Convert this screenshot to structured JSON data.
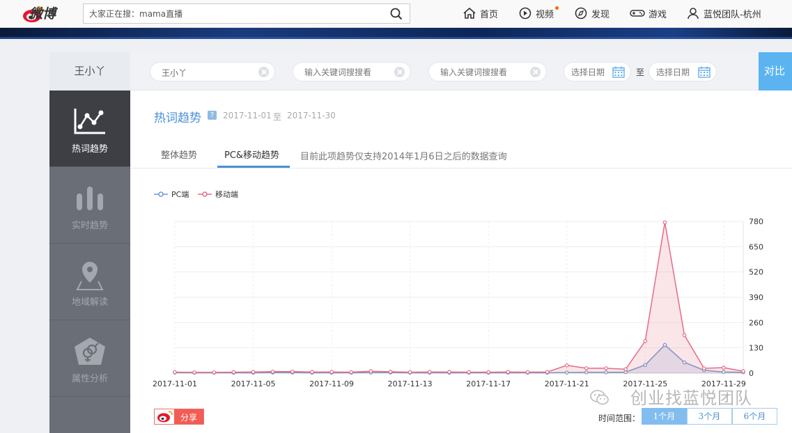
{
  "topbar": {
    "logo_text": "微博",
    "search_placeholder": "大家正在搜：mama直播",
    "nav": [
      {
        "label": "首页",
        "icon": "home-icon"
      },
      {
        "label": "视频",
        "icon": "video-icon"
      },
      {
        "label": "发现",
        "icon": "compass-icon"
      },
      {
        "label": "游戏",
        "icon": "gamepad-icon"
      },
      {
        "label": "蓝悦团队-杭州",
        "icon": "user-icon"
      }
    ]
  },
  "filters": {
    "keyword_label": "王小丫",
    "keyword1_value": "王小丫",
    "keyword2_placeholder": "输入关键词搜搜看",
    "keyword3_placeholder": "输入关键词搜搜看",
    "date_start_placeholder": "选择日期",
    "date_to": "至",
    "date_end_placeholder": "选择日期",
    "compare_label": "对比"
  },
  "sidebar": {
    "items": [
      {
        "label": "热词趋势",
        "icon": "trend-chart-icon",
        "active": true
      },
      {
        "label": "实时趋势",
        "icon": "bar-chart-icon",
        "active": false
      },
      {
        "label": "地域解读",
        "icon": "location-pin-icon",
        "active": false
      },
      {
        "label": "属性分析",
        "icon": "gender-icon",
        "active": false
      }
    ]
  },
  "content": {
    "title": "热词趋势",
    "help": "?",
    "date_from": "2017-11-01",
    "date_sep": "至",
    "date_to": "2017-11-30",
    "tabs": [
      {
        "label": "整体趋势",
        "active": false
      },
      {
        "label": "PC&移动趋势",
        "active": true
      }
    ],
    "note": "目前此项趋势仅支持2014年1月6日之后的数据查询"
  },
  "chart_data": {
    "type": "area",
    "x": [
      "2017-11-01",
      "2017-11-02",
      "2017-11-03",
      "2017-11-04",
      "2017-11-05",
      "2017-11-06",
      "2017-11-07",
      "2017-11-08",
      "2017-11-09",
      "2017-11-10",
      "2017-11-11",
      "2017-11-12",
      "2017-11-13",
      "2017-11-14",
      "2017-11-15",
      "2017-11-16",
      "2017-11-17",
      "2017-11-18",
      "2017-11-19",
      "2017-11-20",
      "2017-11-21",
      "2017-11-22",
      "2017-11-23",
      "2017-11-24",
      "2017-11-25",
      "2017-11-26",
      "2017-11-27",
      "2017-11-28",
      "2017-11-29",
      "2017-11-30"
    ],
    "x_tick_labels": [
      "2017-11-01",
      "2017-11-05",
      "2017-11-09",
      "2017-11-13",
      "2017-11-17",
      "2017-11-21",
      "2017-11-25",
      "2017-11-29"
    ],
    "series": [
      {
        "name": "PC端",
        "color": "#6c9bd2",
        "values": [
          3,
          2,
          2,
          2,
          2,
          3,
          3,
          2,
          2,
          2,
          3,
          3,
          2,
          2,
          2,
          2,
          2,
          2,
          2,
          2,
          3,
          4,
          4,
          5,
          42,
          145,
          55,
          15,
          6,
          4
        ]
      },
      {
        "name": "移动端",
        "color": "#e36d86",
        "values": [
          5,
          4,
          4,
          5,
          6,
          8,
          8,
          6,
          6,
          5,
          10,
          7,
          5,
          6,
          6,
          5,
          5,
          6,
          5,
          6,
          40,
          25,
          25,
          20,
          165,
          775,
          195,
          25,
          28,
          10
        ]
      }
    ],
    "y_ticks": [
      0,
      130,
      260,
      390,
      520,
      650,
      780
    ],
    "ylim": [
      0,
      780
    ],
    "legend_position": "top-left",
    "grid": true
  },
  "footer": {
    "share_label": "分享",
    "watermark_text": "创业找蓝悦团队",
    "range_label": "时间范围：",
    "range_options": [
      {
        "label": "1个月",
        "active": true
      },
      {
        "label": "3个月",
        "active": false
      },
      {
        "label": "6个月",
        "active": false
      }
    ]
  }
}
